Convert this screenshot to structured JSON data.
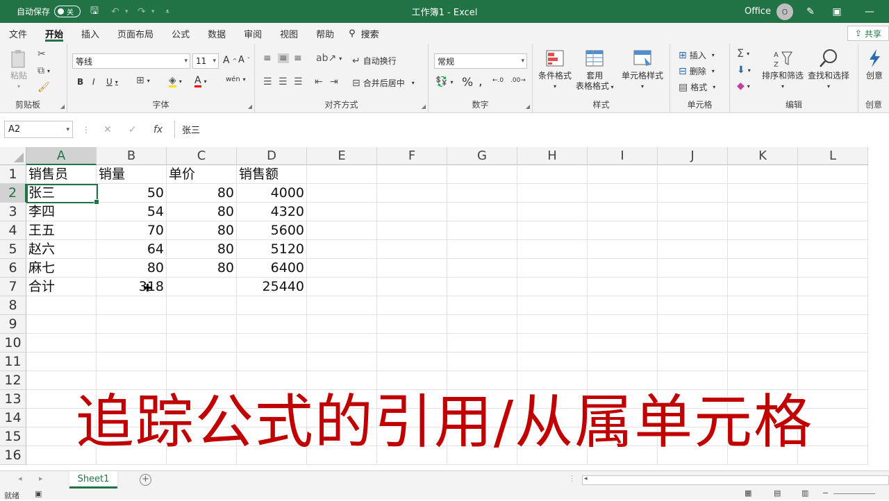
{
  "titlebar": {
    "autosave_label": "自动保存",
    "autosave_state": "关",
    "title": "工作簿1 - Excel",
    "account": "Office",
    "avatar_initial": "O"
  },
  "menu": {
    "tabs": [
      "文件",
      "开始",
      "插入",
      "页面布局",
      "公式",
      "数据",
      "审阅",
      "视图",
      "帮助"
    ],
    "search": "搜索",
    "share": "共享"
  },
  "ribbon": {
    "clipboard": {
      "label": "剪贴板",
      "paste": "粘贴"
    },
    "font": {
      "label": "字体",
      "name": "等线",
      "size": "11",
      "bold": "B",
      "italic": "I",
      "underline": "U",
      "grow": "A",
      "shrink": "A",
      "wen": "wén"
    },
    "align": {
      "label": "对齐方式",
      "wrap": "自动换行",
      "merge": "合并后居中"
    },
    "number": {
      "label": "数字",
      "format": "常规",
      "percent": "%",
      "comma": ","
    },
    "styles": {
      "label": "样式",
      "cond": "条件格式",
      "table1": "套用",
      "table2": "表格格式",
      "cell": "单元格样式"
    },
    "cells": {
      "label": "单元格",
      "insert": "插入",
      "delete": "删除",
      "format": "格式"
    },
    "edit": {
      "label": "编辑",
      "sort": "排序和筛选",
      "find": "查找和选择"
    },
    "idea": {
      "label": "创意",
      "btn": "创意"
    }
  },
  "formula_bar": {
    "name_box": "A2",
    "content": "张三",
    "fx": "fx"
  },
  "grid": {
    "columns": [
      "A",
      "B",
      "C",
      "D",
      "E",
      "F",
      "G",
      "H",
      "I",
      "J",
      "K",
      "L"
    ],
    "rows": [
      "1",
      "2",
      "3",
      "4",
      "5",
      "6",
      "7",
      "8",
      "9",
      "10",
      "11",
      "12",
      "13",
      "14",
      "15",
      "16"
    ],
    "cells": [
      [
        "销售员",
        "销量",
        "单价",
        "销售额"
      ],
      [
        "张三",
        "50",
        "80",
        "4000"
      ],
      [
        "李四",
        "54",
        "80",
        "4320"
      ],
      [
        "王五",
        "70",
        "80",
        "5600"
      ],
      [
        "赵六",
        "64",
        "80",
        "5120"
      ],
      [
        "麻七",
        "80",
        "80",
        "6400"
      ],
      [
        "合计",
        "318",
        "",
        "25440"
      ]
    ]
  },
  "overlay_text": "追踪公式的引用/从属单元格",
  "sheets": [
    "Sheet1"
  ],
  "status": {
    "ready": "就绪"
  }
}
